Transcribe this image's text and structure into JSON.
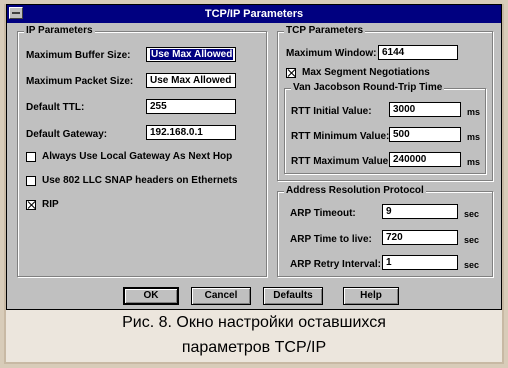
{
  "window": {
    "title": "TCP/IP Parameters"
  },
  "ip_params": {
    "title": "IP Parameters",
    "max_buffer_label": "Maximum Buffer Size:",
    "max_buffer_value": "Use Max Allowed",
    "max_packet_label": "Maximum Packet Size:",
    "max_packet_value": "Use Max Allowed",
    "ttl_label": "Default TTL:",
    "ttl_value": "255",
    "gateway_label": "Default Gateway:",
    "gateway_value": "192.168.0.1",
    "local_gateway_label": "Always Use Local Gateway As Next Hop",
    "local_gateway_checked": false,
    "snap_label": "Use 802 LLC SNAP headers on Ethernets",
    "snap_checked": false,
    "rip_label": "RIP",
    "rip_checked": true
  },
  "tcp_params": {
    "title": "TCP Parameters",
    "max_window_label": "Maximum Window:",
    "max_window_value": "6144",
    "max_segment_label": "Max Segment Negotiations",
    "max_segment_checked": true
  },
  "rtt": {
    "title": "Van Jacobson Round-Trip Time",
    "initial_label": "RTT Initial Value:",
    "initial_value": "3000",
    "minimum_label": "RTT Minimum Value:",
    "minimum_value": "500",
    "maximum_label": "RTT Maximum Value:",
    "maximum_value": "240000",
    "unit": "ms"
  },
  "arp": {
    "title": "Address Resolution Protocol",
    "timeout_label": "ARP Timeout:",
    "timeout_value": "9",
    "ttl_label": "ARP Time to live:",
    "ttl_value": "720",
    "retry_label": "ARP Retry Interval:",
    "retry_value": "1",
    "unit": "sec"
  },
  "buttons": {
    "ok": "OK",
    "cancel": "Cancel",
    "defaults": "Defaults",
    "help": "Help"
  },
  "caption": {
    "line1": "Рис. 8. Окно настройки оставшихся",
    "line2": "параметров TCP/IP"
  }
}
